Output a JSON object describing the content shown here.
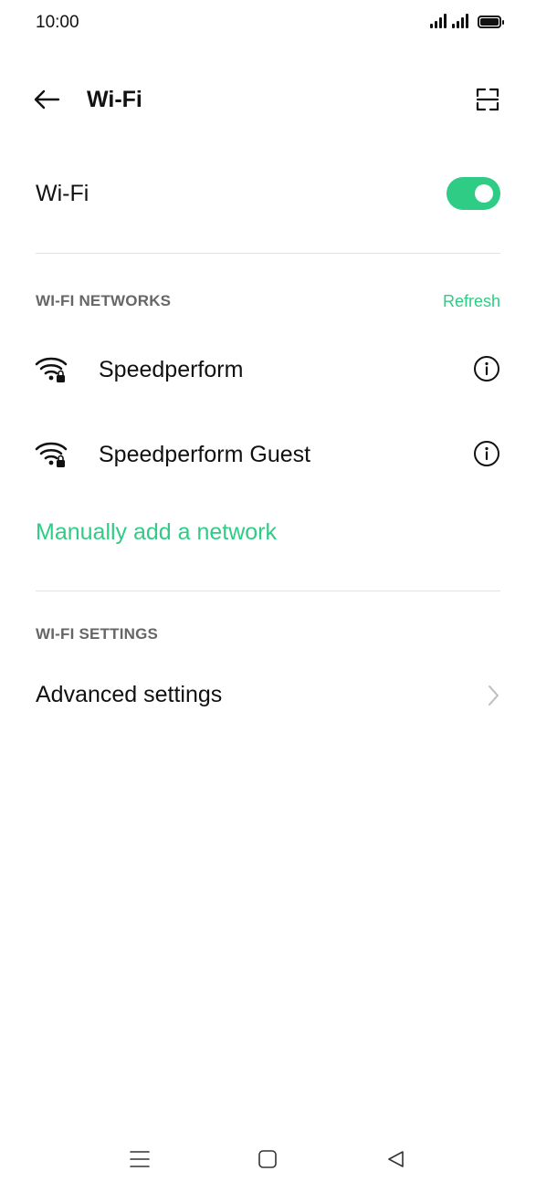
{
  "status_bar": {
    "time": "10:00",
    "icons": [
      "signal-icon",
      "signal-icon",
      "battery-icon"
    ]
  },
  "header": {
    "title": "Wi-Fi",
    "back_icon": "back-arrow-icon",
    "scan_icon": "qr-scan-icon"
  },
  "wifi_toggle": {
    "label": "Wi-Fi",
    "state": "on"
  },
  "networks": {
    "section_title": "WI-FI NETWORKS",
    "refresh_label": "Refresh",
    "items": [
      {
        "name": "Speedperform",
        "icon": "wifi-locked-icon",
        "info_icon": "info-icon"
      },
      {
        "name": "Speedperform Guest",
        "icon": "wifi-locked-icon",
        "info_icon": "info-icon"
      }
    ],
    "manual_add_label": "Manually add a network"
  },
  "settings": {
    "section_title": "WI-FI SETTINGS",
    "advanced_label": "Advanced settings"
  },
  "colors": {
    "accent": "#2ecc84",
    "section_header": "#666666",
    "divider": "#e2e2e2"
  },
  "nav_bar": {
    "icons": [
      "menu-icon",
      "home-icon",
      "back-triangle-icon"
    ]
  }
}
